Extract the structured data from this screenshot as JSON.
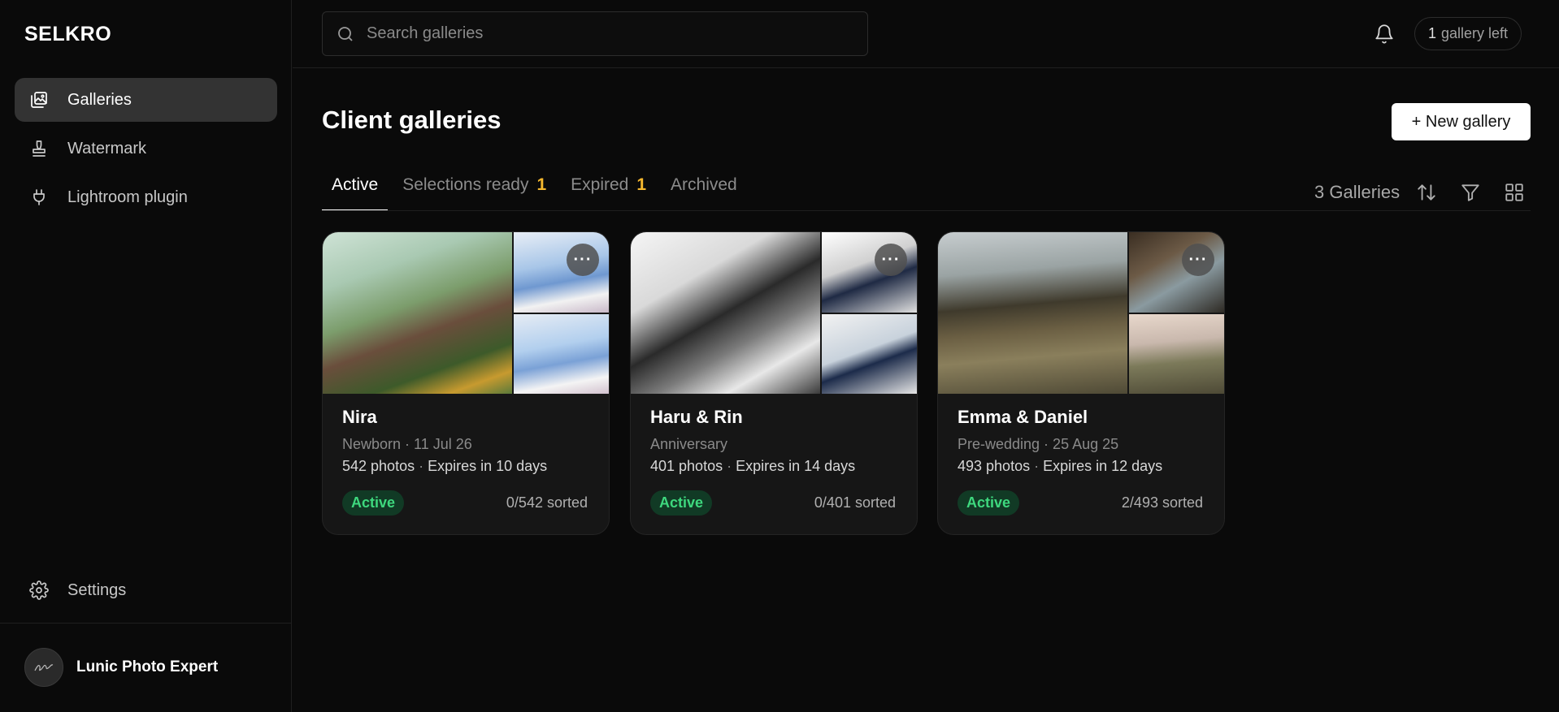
{
  "app": {
    "logo": "SELKRO"
  },
  "sidebar": {
    "items": [
      {
        "label": "Galleries",
        "icon": "galleries-icon",
        "active": true
      },
      {
        "label": "Watermark",
        "icon": "stamp-icon",
        "active": false
      },
      {
        "label": "Lightroom plugin",
        "icon": "plug-icon",
        "active": false
      }
    ],
    "settings_label": "Settings",
    "user_name": "Lunic Photo Expert"
  },
  "topbar": {
    "search_placeholder": "Search galleries",
    "quota_number": "1",
    "quota_text": "gallery left"
  },
  "main": {
    "title": "Client galleries",
    "new_button": "+ New gallery",
    "tabs": [
      {
        "label": "Active",
        "count": "",
        "active": true
      },
      {
        "label": "Selections ready",
        "count": "1",
        "active": false
      },
      {
        "label": "Expired",
        "count": "1",
        "active": false
      },
      {
        "label": "Archived",
        "count": "",
        "active": false
      }
    ],
    "gallery_count": "3 Galleries"
  },
  "galleries": [
    {
      "name": "Nira",
      "type_date": "Newborn · 11 Jul 26",
      "photos": "542 photos",
      "expires": "Expires in 10 days",
      "status": "Active",
      "sorted": "0/542 sorted"
    },
    {
      "name": "Haru & Rin",
      "type_date": "Anniversary",
      "photos": "401 photos",
      "expires": "Expires in 14 days",
      "status": "Active",
      "sorted": "0/401 sorted"
    },
    {
      "name": "Emma & Daniel",
      "type_date": "Pre-wedding · 25 Aug 25",
      "photos": "493 photos",
      "expires": "Expires in 12 days",
      "status": "Active",
      "sorted": "2/493 sorted"
    }
  ],
  "colors": {
    "background": "#0a0a0a",
    "accent_count": "#f5b82e",
    "status_active_text": "#3ed87e",
    "status_active_bg": "#113a25"
  }
}
